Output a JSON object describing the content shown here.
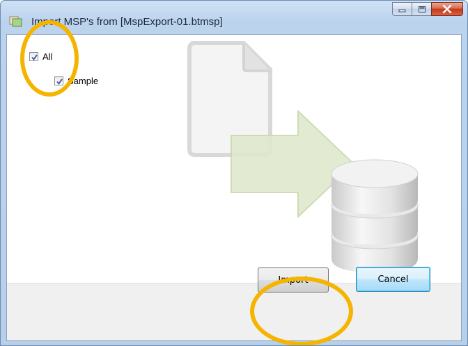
{
  "window": {
    "title": "Import MSP's from [MspExport-01.btmsp]"
  },
  "caption_buttons": {
    "minimize_icon": "minimize-icon",
    "maximize_icon": "maximize-icon",
    "close_icon": "close-icon"
  },
  "tree": {
    "items": [
      {
        "label": "All",
        "checked": true
      },
      {
        "label": "Sample",
        "checked": true
      }
    ]
  },
  "buttons": {
    "import_label": "Import",
    "cancel_label": "Cancel"
  },
  "illustration": {
    "icons": [
      "document-icon",
      "arrow-right-icon",
      "database-icon"
    ]
  },
  "colors": {
    "highlight": "#f5b400",
    "title_bar": "#bcd3ee",
    "close_button": "#c3391c",
    "arrow": "#dce8c8"
  }
}
